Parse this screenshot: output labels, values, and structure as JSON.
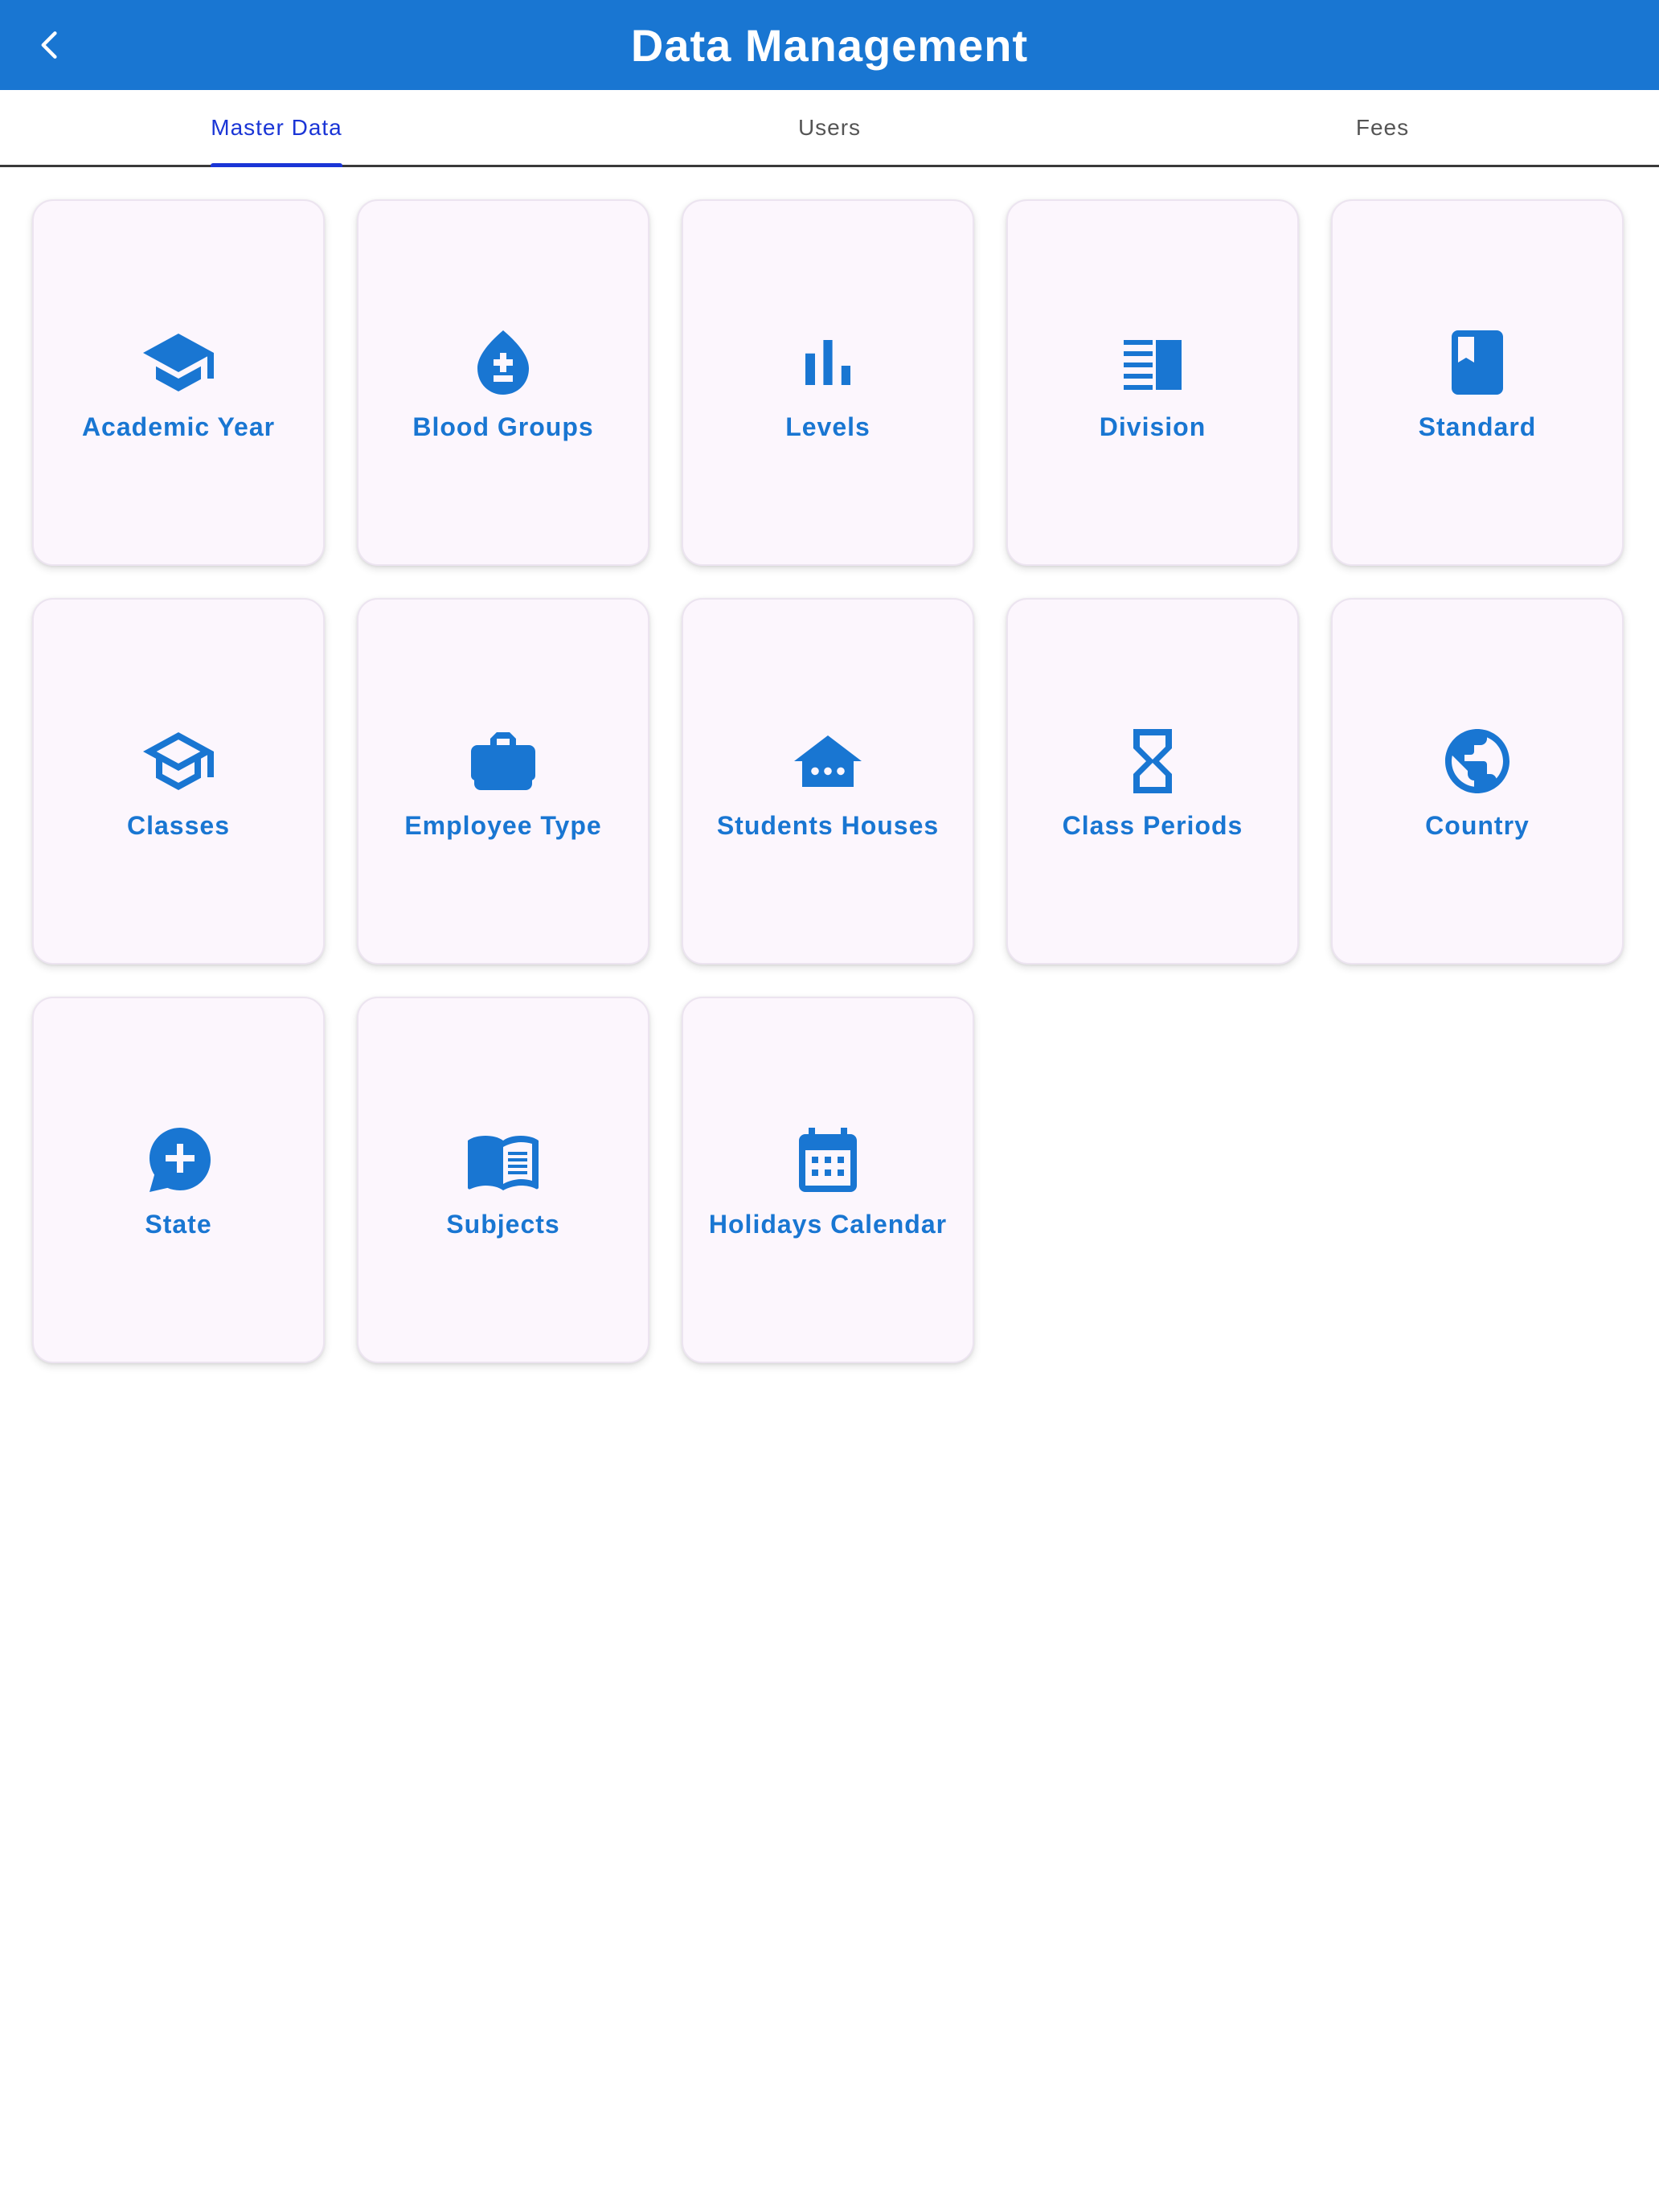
{
  "header": {
    "title": "Data Management",
    "back_icon": "chevron-left-icon",
    "background": "#1976d2"
  },
  "tabs": [
    {
      "label": "Master Data",
      "active": true
    },
    {
      "label": "Users",
      "active": false
    },
    {
      "label": "Fees",
      "active": false
    }
  ],
  "colors": {
    "accent": "#1976d2",
    "tab_active": "#1a35d6",
    "card_bg": "#fcf6fd"
  },
  "cards": [
    {
      "label": "Academic Year",
      "icon": "graduation-cap-icon"
    },
    {
      "label": "Blood Groups",
      "icon": "blood-drop-icon"
    },
    {
      "label": "Levels",
      "icon": "bar-chart-icon"
    },
    {
      "label": "Division",
      "icon": "view-list-icon"
    },
    {
      "label": "Standard",
      "icon": "bookmark-book-icon"
    },
    {
      "label": "Classes",
      "icon": "graduation-cap-outline-icon"
    },
    {
      "label": "Employee Type",
      "icon": "briefcase-icon"
    },
    {
      "label": "Students Houses",
      "icon": "house-icon"
    },
    {
      "label": "Class Periods",
      "icon": "hourglass-icon"
    },
    {
      "label": "Country",
      "icon": "globe-icon"
    },
    {
      "label": "State",
      "icon": "add-comment-icon"
    },
    {
      "label": "Subjects",
      "icon": "open-book-icon"
    },
    {
      "label": "Holidays Calendar",
      "icon": "calendar-icon"
    }
  ]
}
